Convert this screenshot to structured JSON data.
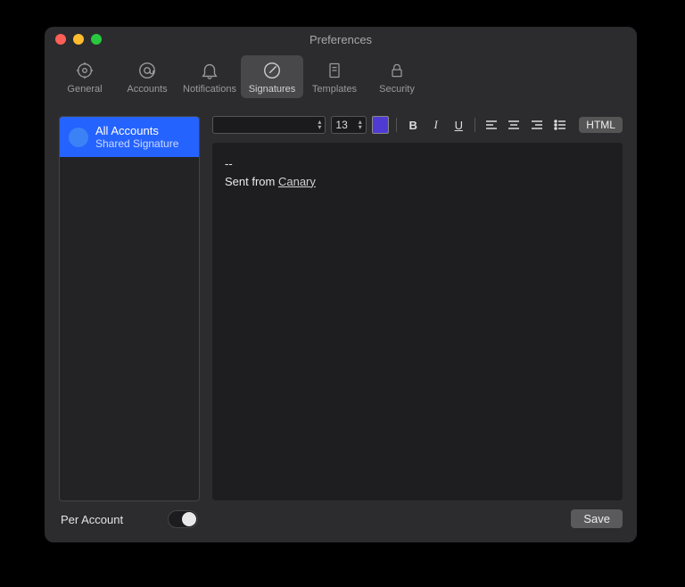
{
  "window": {
    "title": "Preferences"
  },
  "tabs": [
    {
      "label": "General"
    },
    {
      "label": "Accounts"
    },
    {
      "label": "Notifications"
    },
    {
      "label": "Signatures"
    },
    {
      "label": "Templates"
    },
    {
      "label": "Security"
    }
  ],
  "active_tab_index": 3,
  "sidebar": {
    "items": [
      {
        "title": "All Accounts",
        "subtitle": "Shared Signature"
      }
    ],
    "per_account_label": "Per Account",
    "per_account_on": false
  },
  "editor": {
    "font_family": "",
    "font_size": "13",
    "text_color": "#4f3bd4",
    "html_button": "HTML",
    "body_prefix": "--",
    "body_line": "Sent from ",
    "body_link": "Canary",
    "save_label": "Save"
  }
}
